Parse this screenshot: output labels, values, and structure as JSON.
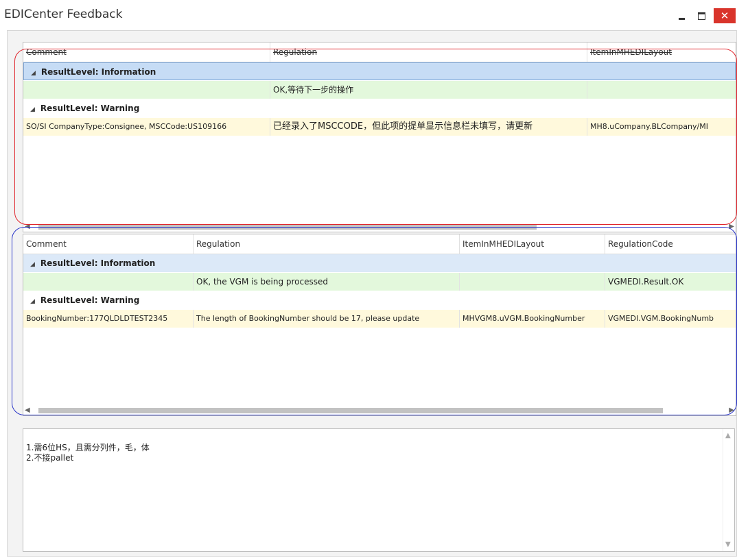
{
  "window": {
    "title": "EDICenter Feedback",
    "close_glyph": "✕"
  },
  "grid1": {
    "columns": [
      "Comment",
      "Regulation",
      "ItemInMHEDILayout"
    ],
    "group_info": "ResultLevel: Information",
    "row_ok": [
      "",
      "OK,等待下一步的操作",
      ""
    ],
    "group_warning": "ResultLevel: Warning",
    "row_warning": [
      "SO/SI CompanyType:Consignee, MSCCode:US109166",
      "已经录入了MSCCODE，但此项的提单显示信息栏未填写，请更新",
      "MH8.uCompany.BLCompany/MI"
    ]
  },
  "grid2": {
    "columns": [
      "Comment",
      "Regulation",
      "ItemInMHEDILayout",
      "RegulationCode"
    ],
    "group_info": "ResultLevel: Information",
    "row_ok": [
      "",
      "OK, the VGM is being processed",
      "",
      "VGMEDI.Result.OK"
    ],
    "group_warning": "ResultLevel: Warning",
    "row_warning": [
      "BookingNumber:177QLDLDTEST2345",
      "The length of BookingNumber should be 17, please update",
      "MHVGM8.uVGM.BookingNumber",
      "VGMEDI.VGM.BookingNumb"
    ]
  },
  "notes": {
    "line1": "1.需6位HS，且需分列件，毛，体",
    "line2": "2.不接pallet"
  },
  "icons": {
    "minimize": "minimize-icon",
    "maximize": "maximize-icon",
    "close": "close-icon",
    "expand": "triangle-down-icon"
  },
  "colors": {
    "info_group_bg": "#dce9f8",
    "ok_row_bg": "#e3f8dc",
    "warning_row_bg": "#fff9dc",
    "close_button": "#d9342b",
    "annotation_red": "#e0262d",
    "annotation_blue": "#2a36c9"
  }
}
